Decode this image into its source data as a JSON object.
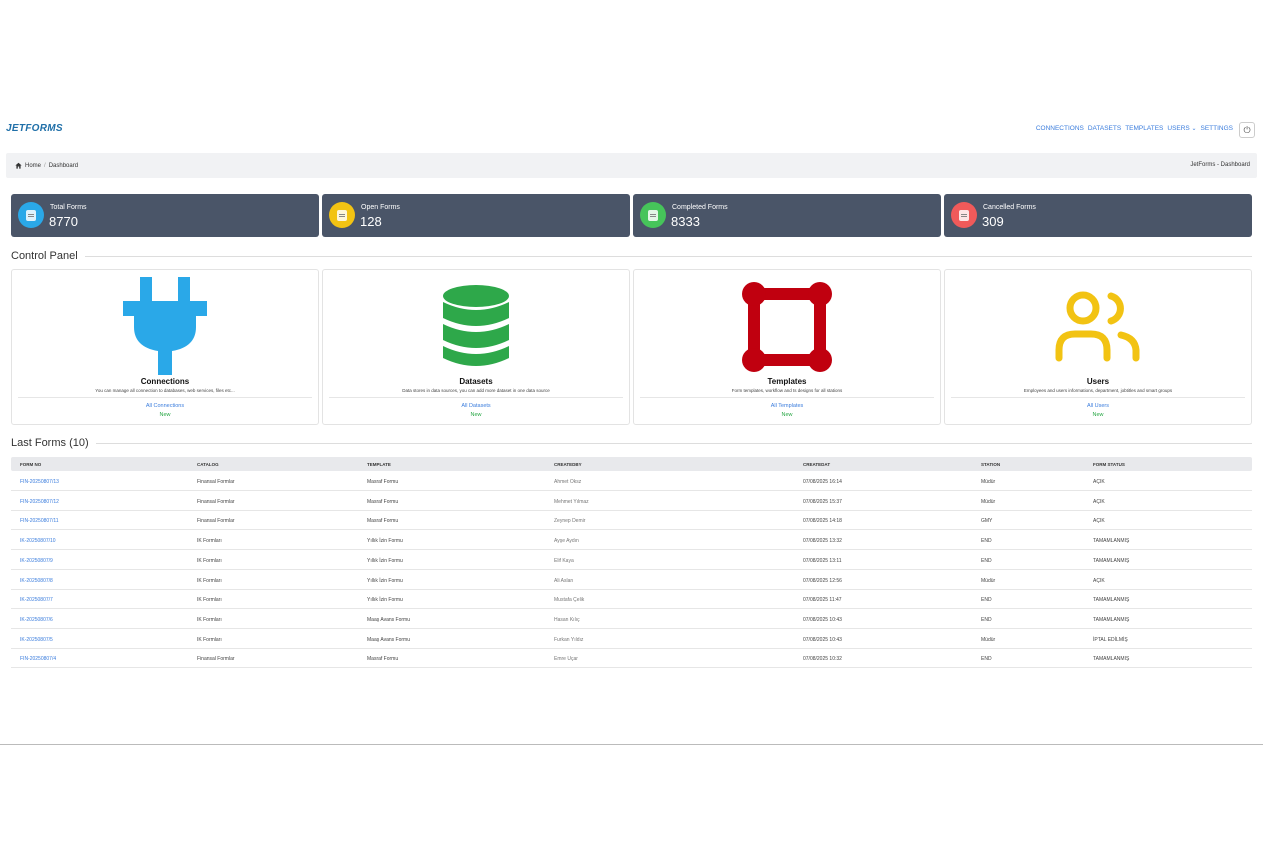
{
  "brand": {
    "logo_text": "JETFORMS"
  },
  "nav": {
    "connections": "CONNECTIONS",
    "datasets": "DATASETS",
    "templates": "TEMPLATES",
    "users": "USERS",
    "settings": "SETTINGS"
  },
  "breadcrumb": {
    "home": "Home",
    "separator": "/",
    "current": "Dashboard",
    "right": "JetForms - Dashboard"
  },
  "stats": [
    {
      "label": "Total Forms",
      "value": "8770",
      "color": "#2aa8e8"
    },
    {
      "label": "Open Forms",
      "value": "128",
      "color": "#f2c313"
    },
    {
      "label": "Completed Forms",
      "value": "8333",
      "color": "#46c45a"
    },
    {
      "label": "Cancelled Forms",
      "value": "309",
      "color": "#f05a5a"
    }
  ],
  "control_panel": {
    "title": "Control Panel",
    "cards": [
      {
        "title": "Connections",
        "desc": "You can manage all connection to databases, web services, files etc...",
        "link": "All Connections",
        "new": "New",
        "icon": "plug-icon",
        "color": "#2aa8e8"
      },
      {
        "title": "Datasets",
        "desc": "Data stores in data sources, you can add more dataset in one data source",
        "link": "All Datasets",
        "new": "New",
        "icon": "database-icon",
        "color": "#2ea84a"
      },
      {
        "title": "Templates",
        "desc": "Form templates, workflow and ts designs for all stations",
        "link": "All Templates",
        "new": "New",
        "icon": "template-icon",
        "color": "#c0000f"
      },
      {
        "title": "Users",
        "desc": "Employees and users informations, department, jobtitles and smart groups",
        "link": "All Users",
        "new": "New",
        "icon": "users-icon",
        "color": "#f2c313"
      }
    ]
  },
  "last_forms": {
    "title": "Last Forms (10)",
    "columns": [
      "FORM NO",
      "CATALOG",
      "TEMPLATE",
      "CREATEDBY",
      "CREATEDAT",
      "STATION",
      "FORM STATUS"
    ],
    "rows": [
      [
        "FIN-20250807/13",
        "Finansal Formlar",
        "Masraf Formu",
        "Ahmet Oksz",
        "07/08/2025 16:14",
        "Müdür",
        "AÇIK"
      ],
      [
        "FIN-20250807/12",
        "Finansal Formlar",
        "Masraf Formu",
        "Mehmet Yılmaz",
        "07/08/2025 15:37",
        "Müdür",
        "AÇIK"
      ],
      [
        "FIN-20250807/11",
        "Finansal Formlar",
        "Masraf Formu",
        "Zeynep Demir",
        "07/08/2025 14:18",
        "GMY",
        "AÇIK"
      ],
      [
        "IK-20250807/10",
        "IK Formları",
        "Yıllık İzin Formu",
        "Ayşe Aydın",
        "07/08/2025 13:32",
        "END",
        "TAMAMLANMIŞ"
      ],
      [
        "IK-20250807/9",
        "IK Formları",
        "Yıllık İzin Formu",
        "Elif Kaya",
        "07/08/2025 13:11",
        "END",
        "TAMAMLANMIŞ"
      ],
      [
        "IK-20250807/8",
        "IK Formları",
        "Yıllık İzin Formu",
        "Ali Aslan",
        "07/08/2025 12:56",
        "Müdür",
        "AÇIK"
      ],
      [
        "IK-20250807/7",
        "IK Formları",
        "Yıllık İzin Formu",
        "Mustafa Çelik",
        "07/08/2025 11:47",
        "END",
        "TAMAMLANMIŞ"
      ],
      [
        "IK-20250807/6",
        "IK Formları",
        "Maaş Avans Formu",
        "Hasan Kılıç",
        "07/08/2025 10:43",
        "END",
        "TAMAMLANMIŞ"
      ],
      [
        "IK-20250807/5",
        "IK Formları",
        "Maaş Avans Formu",
        "Furkan Yıldız",
        "07/08/2025 10:43",
        "Müdür",
        "İPTAL EDİLMİŞ"
      ],
      [
        "FIN-20250807/4",
        "Finansal Formlar",
        "Masraf Formu",
        "Emre Uçar",
        "07/08/2025 10:32",
        "END",
        "TAMAMLANMIŞ"
      ]
    ]
  }
}
